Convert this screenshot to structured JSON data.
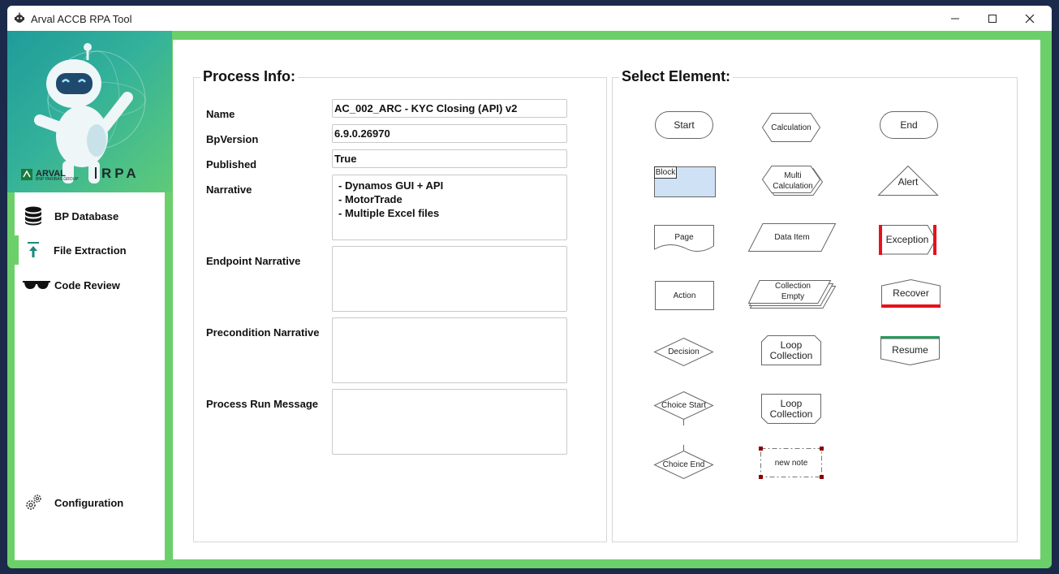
{
  "window": {
    "title": "Arval ACCB RPA Tool"
  },
  "brand": {
    "name": "ARVAL",
    "tagline": "BNP PARIBAS GROUP",
    "product": "RPA"
  },
  "nav": {
    "items": [
      {
        "label": "BP Database",
        "icon": "database-icon"
      },
      {
        "label": "File Extraction",
        "icon": "upload-icon",
        "active": true
      },
      {
        "label": "Code Review",
        "icon": "sunglasses-icon"
      }
    ],
    "config_label": "Configuration"
  },
  "process_info": {
    "title": "Process Info:",
    "fields": {
      "name": {
        "label": "Name",
        "value": "AC_002_ARC - KYC Closing (API) v2"
      },
      "bpversion": {
        "label": "BpVersion",
        "value": "6.9.0.26970"
      },
      "published": {
        "label": "Published",
        "value": "True"
      },
      "narrative": {
        "label": "Narrative",
        "lines": [
          "- Dynamos GUI + API",
          "- MotorTrade",
          "- Multiple Excel files"
        ]
      },
      "endpoint_narrative": {
        "label": "Endpoint Narrative",
        "value": ""
      },
      "precondition_narrative": {
        "label": "Precondition Narrative",
        "value": ""
      },
      "process_run_message": {
        "label": "Process Run Message",
        "value": ""
      }
    }
  },
  "select_element": {
    "title": "Select Element:",
    "elements": {
      "start": "Start",
      "calculation": "Calculation",
      "end": "End",
      "block": "Block",
      "multi_calculation_1": "Multi",
      "multi_calculation_2": "Calculation",
      "alert": "Alert",
      "page": "Page",
      "data_item": "Data Item",
      "exception": "Exception",
      "action": "Action",
      "collection_1": "Collection",
      "collection_2": "Empty",
      "recover": "Recover",
      "decision": "Decision",
      "loop_start_1": "Loop",
      "loop_start_2": "Collection",
      "resume": "Resume",
      "choice_start": "Choice Start",
      "loop_end_1": "Loop",
      "loop_end_2": "Collection",
      "choice_end": "Choice End",
      "note": "new note"
    }
  },
  "colors": {
    "accent": "#6bd06a",
    "block_fill": "#cfe1f5",
    "exception_bar": "#e8101c",
    "recover_bar": "#e8101c",
    "resume_bar": "#1fa05a"
  }
}
